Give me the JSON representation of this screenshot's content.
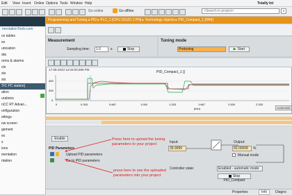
{
  "menu": [
    "Edit",
    "View",
    "Insert",
    "Online",
    "Options",
    "Tools",
    "Window",
    "Help"
  ],
  "toolbar": {
    "go_online": "Go online",
    "go_offline": "Go offline",
    "search_placeholder": "<Search in project>",
    "brand": "Totally Int"
  },
  "left_panel": {
    "site": "mentationTools.com",
    "items": [
      "ce tables",
      "es",
      "unication",
      "ata",
      "orms & alarms",
      "cts",
      "sts",
      "sts",
      "TIC PC station]",
      "ation",
      "urations",
      "nCC RT Advan...",
      "onfiguration",
      "ettings",
      "ow screen",
      "gement",
      "es",
      "s",
      "ions",
      "mentation",
      "ntation"
    ],
    "selected_index": 8
  },
  "titlebar": "Programming and Tuning a PID ▸ PLC_1 [CPU 1512C-1 PN] ▸ Technology objects ▸ PID_Compact_1 [DB4]",
  "measurement": {
    "title": "Measurement",
    "sampling_label": "Sampling time:",
    "sampling_value": "1.0",
    "sampling_unit": "s",
    "stop_label": "Stop"
  },
  "tuning": {
    "title": "Tuning mode",
    "mode_value": "Pretuning",
    "start_label": "Start"
  },
  "trend": {
    "timestamp": "17-08-2023  12:03:00.889 PM",
    "title": "PID_Compact_1 []",
    "yticks": [
      "400",
      "200",
      "0"
    ],
    "xticks": [
      "0",
      "0.333",
      "0.667",
      "1.000",
      "1.333",
      "1.667",
      "2.000",
      "2.333"
    ],
    "xunit": "[min]",
    "scale_label": "Automatic"
  },
  "bottom": {
    "enable_label": "Enable",
    "pid_params_title": "PID Parameters",
    "upload_label": "Upload PID parameters",
    "goto_label": "Go to PID parameters",
    "input_label": "Input:",
    "input_value": "39.9999",
    "output_label": "Output:",
    "output_value": "60.00008",
    "output_unit": "%",
    "manual_label": "Manual mode",
    "ctrl_state_label": "Controller state:",
    "ctrl_state_value": "Enabled - automatic mode",
    "stop_pid_label": "Stop PID_Compact",
    "anno1": "Press here to upload the tuning parameters to your project",
    "anno2": "press here to see the uploaded parameters into your project"
  },
  "status": {
    "properties": "Properties",
    "info": "Info",
    "diagnostics": "Diagno"
  },
  "colors": {
    "accent": "#e69319",
    "setpoint": "#1b1b1b",
    "process": "#d93a3a",
    "output": "#1fa84a",
    "anno": "#e01818"
  }
}
